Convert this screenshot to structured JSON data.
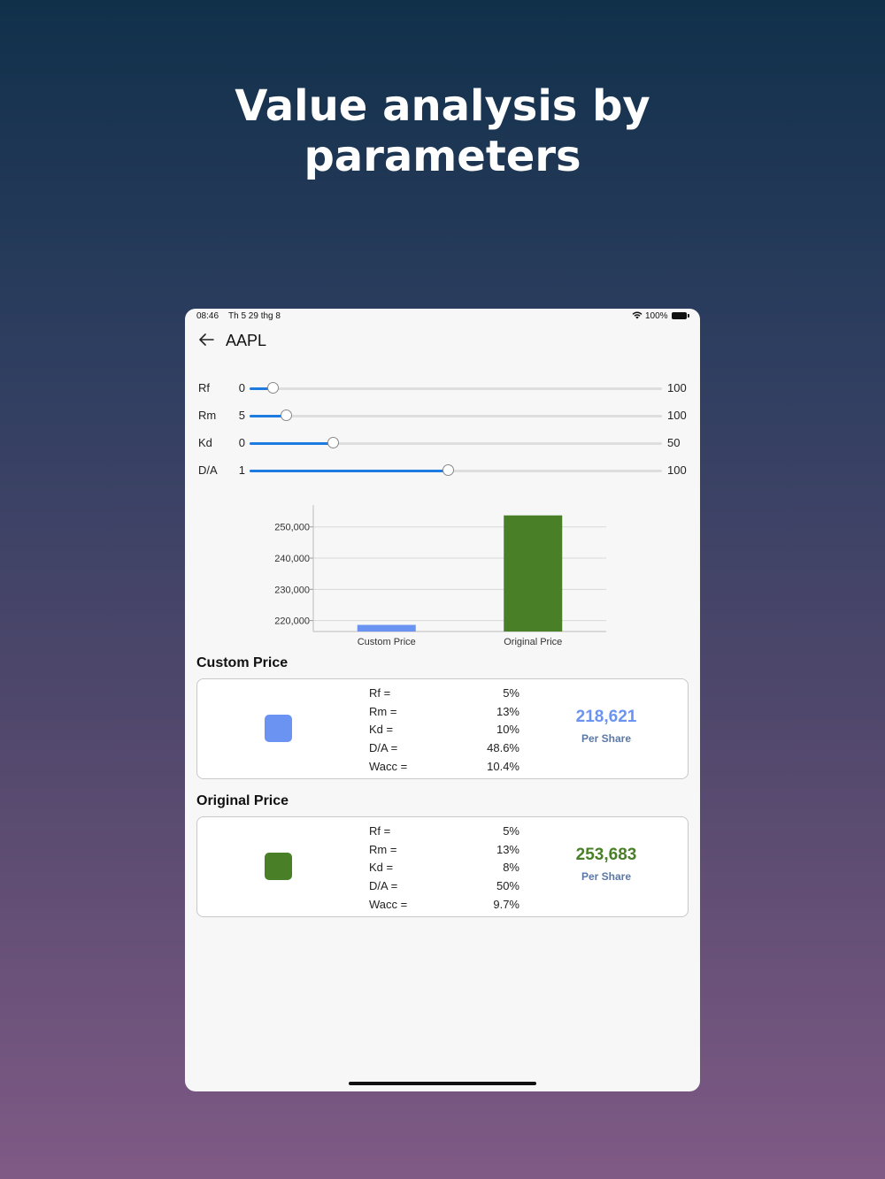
{
  "headline": {
    "line1": "Value analysis by",
    "line2": "parameters"
  },
  "status_bar": {
    "time": "08:46",
    "date": "Th 5 29 thg 8",
    "battery": "100%"
  },
  "nav": {
    "title": "AAPL"
  },
  "sliders": [
    {
      "label": "Rf",
      "min": "0",
      "max": "100",
      "level": 0.058
    },
    {
      "label": "Rm",
      "min": "5",
      "max": "100",
      "level": 0.09
    },
    {
      "label": "Kd",
      "min": "0",
      "max": "50",
      "level": 0.204
    },
    {
      "label": "D/A",
      "min": "1",
      "max": "100",
      "level": 0.482
    }
  ],
  "colors": {
    "custom": "#6b93f2",
    "original": "#497f27",
    "slider_active": "#1e7be0"
  },
  "chart_data": {
    "type": "bar",
    "categories": [
      "Custom Price",
      "Original Price"
    ],
    "values": [
      218621,
      253683
    ],
    "ylim": [
      216500,
      257000
    ],
    "yticks": [
      220000,
      230000,
      240000,
      250000
    ],
    "ytick_labels": [
      "220,000",
      "230,000",
      "240,000",
      "250,000"
    ],
    "grid": true
  },
  "custom": {
    "title": "Custom Price",
    "params": [
      {
        "k": "Rf =",
        "v": "5%"
      },
      {
        "k": "Rm =",
        "v": "13%"
      },
      {
        "k": "Kd =",
        "v": "10%"
      },
      {
        "k": "D/A =",
        "v": "48.6%"
      },
      {
        "k": "Wacc =",
        "v": "10.4%"
      }
    ],
    "price": "218,621",
    "per_share": "Per Share"
  },
  "original": {
    "title": "Original Price",
    "params": [
      {
        "k": "Rf =",
        "v": "5%"
      },
      {
        "k": "Rm =",
        "v": "13%"
      },
      {
        "k": "Kd =",
        "v": "8%"
      },
      {
        "k": "D/A =",
        "v": "50%"
      },
      {
        "k": "Wacc =",
        "v": "9.7%"
      }
    ],
    "price": "253,683",
    "per_share": "Per Share"
  }
}
